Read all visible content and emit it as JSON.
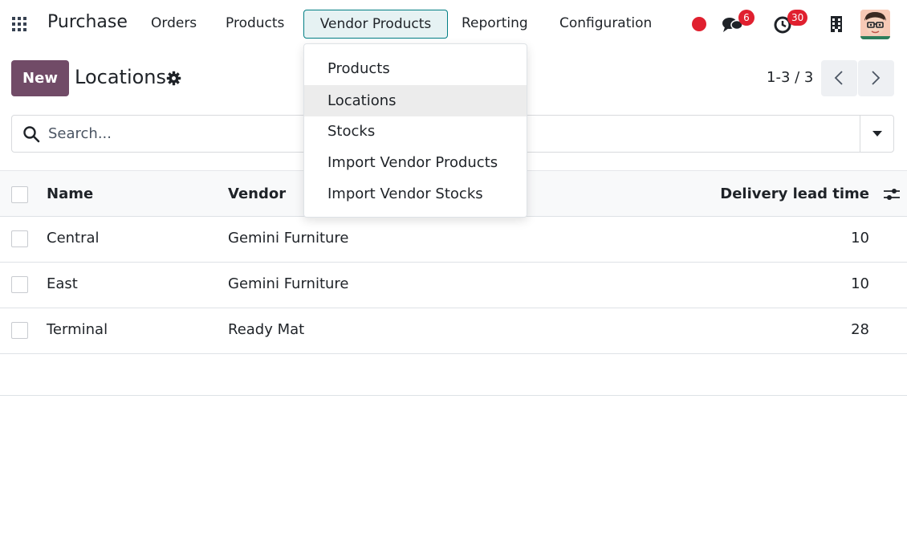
{
  "navbar": {
    "brand": "Purchase",
    "menu": [
      "Orders",
      "Products",
      "Vendor Products",
      "Reporting",
      "Configuration"
    ],
    "chat_badge": "6",
    "activity_badge": "30",
    "icons": [
      "apps-grid-icon",
      "record-dot-icon",
      "chat-icon",
      "clock-icon",
      "building-icon",
      "user-avatar"
    ]
  },
  "dropdown": {
    "items": [
      "Products",
      "Locations",
      "Stocks",
      "Import Vendor Products",
      "Import Vendor Stocks"
    ],
    "active_index": 1
  },
  "control": {
    "new_label": "New",
    "title": "Locations",
    "pager": "1-3 / 3"
  },
  "search": {
    "placeholder": "Search..."
  },
  "table": {
    "columns": [
      "Name",
      "Vendor",
      "Delivery lead time"
    ],
    "rows": [
      {
        "name": "Central",
        "vendor": "Gemini Furniture",
        "lead_time": "10"
      },
      {
        "name": "East",
        "vendor": "Gemini Furniture",
        "lead_time": "10"
      },
      {
        "name": "Terminal",
        "vendor": "Ready Mat",
        "lead_time": "28"
      }
    ]
  },
  "colors": {
    "primary": "#714b67",
    "accent": "#017e84",
    "badge": "#e0202f"
  }
}
